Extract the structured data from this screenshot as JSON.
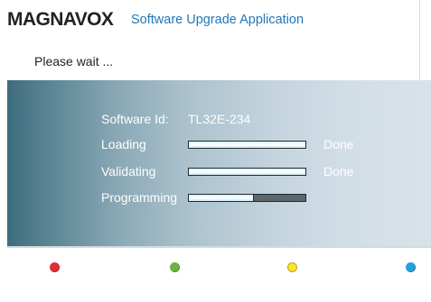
{
  "header": {
    "brand": "MAGNAVOX",
    "app_title": "Software Upgrade Application"
  },
  "status_text": "Please wait ...",
  "info": {
    "software_id_label": "Software Id:",
    "software_id_value": "TL32E-234"
  },
  "steps": [
    {
      "label": "Loading",
      "progress": 1.0,
      "status": "Done"
    },
    {
      "label": "Validating",
      "progress": 1.0,
      "status": "Done"
    },
    {
      "label": "Programming",
      "progress": 0.55,
      "status": ""
    }
  ],
  "color_keys": [
    {
      "name": "red-key",
      "color": "#e03036"
    },
    {
      "name": "green-key",
      "color": "#6db33f"
    },
    {
      "name": "yellow-key",
      "color": "#f7e43a"
    },
    {
      "name": "blue-key",
      "color": "#2aa0db"
    }
  ]
}
